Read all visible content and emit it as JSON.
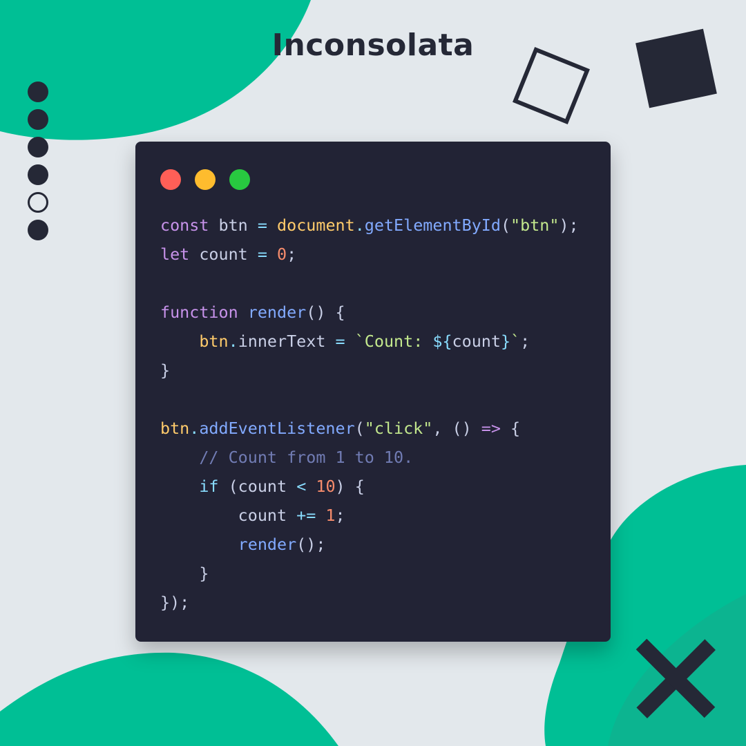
{
  "title": "Inconsolata",
  "colors": {
    "background": "#e3e8ec",
    "accent_green": "#00bf95",
    "dark": "#252836",
    "card": "#222335",
    "traffic_red": "#ff5f57",
    "traffic_yellow": "#febc2e",
    "traffic_green": "#28c840"
  },
  "decorations": {
    "nav_dots": [
      "filled",
      "filled",
      "filled",
      "filled",
      "hollow",
      "filled"
    ],
    "shapes": [
      "outline-square-icon",
      "filled-square-icon",
      "cross-icon"
    ]
  },
  "window": {
    "traffic_lights": [
      "close-icon",
      "minimize-icon",
      "maximize-icon"
    ]
  },
  "code": {
    "lines": [
      [
        [
          "kw",
          "const"
        ],
        [
          "pl",
          " btn "
        ],
        [
          "op",
          "="
        ],
        [
          "pl",
          " "
        ],
        [
          "obj",
          "document"
        ],
        [
          "op",
          "."
        ],
        [
          "fn",
          "getElementById"
        ],
        [
          "pl",
          "("
        ],
        [
          "str",
          "\"btn\""
        ],
        [
          "pl",
          ");"
        ]
      ],
      [
        [
          "kw",
          "let"
        ],
        [
          "pl",
          " count "
        ],
        [
          "op",
          "="
        ],
        [
          "pl",
          " "
        ],
        [
          "num",
          "0"
        ],
        [
          "pl",
          ";"
        ]
      ],
      [],
      [
        [
          "kw",
          "function"
        ],
        [
          "pl",
          " "
        ],
        [
          "fn",
          "render"
        ],
        [
          "pl",
          "() {"
        ]
      ],
      [
        [
          "pl",
          "    "
        ],
        [
          "obj",
          "btn"
        ],
        [
          "op",
          "."
        ],
        [
          "pl",
          "innerText "
        ],
        [
          "op",
          "="
        ],
        [
          "pl",
          " "
        ],
        [
          "str",
          "`Count: "
        ],
        [
          "op",
          "${"
        ],
        [
          "pl",
          "count"
        ],
        [
          "op",
          "}"
        ],
        [
          "str",
          "`"
        ],
        [
          "pl",
          ";"
        ]
      ],
      [
        [
          "pl",
          "}"
        ]
      ],
      [],
      [
        [
          "obj",
          "btn"
        ],
        [
          "op",
          "."
        ],
        [
          "fn",
          "addEventListener"
        ],
        [
          "pl",
          "("
        ],
        [
          "str",
          "\"click\""
        ],
        [
          "pl",
          ", () "
        ],
        [
          "kw",
          "=>"
        ],
        [
          "pl",
          " {"
        ]
      ],
      [
        [
          "pl",
          "    "
        ],
        [
          "cm",
          "// Count from 1 to 10."
        ]
      ],
      [
        [
          "pl",
          "    "
        ],
        [
          "op",
          "if"
        ],
        [
          "pl",
          " (count "
        ],
        [
          "op",
          "<"
        ],
        [
          "pl",
          " "
        ],
        [
          "num",
          "10"
        ],
        [
          "pl",
          ") {"
        ]
      ],
      [
        [
          "pl",
          "        count "
        ],
        [
          "op",
          "+="
        ],
        [
          "pl",
          " "
        ],
        [
          "num",
          "1"
        ],
        [
          "pl",
          ";"
        ]
      ],
      [
        [
          "pl",
          "        "
        ],
        [
          "fn",
          "render"
        ],
        [
          "pl",
          "();"
        ]
      ],
      [
        [
          "pl",
          "    }"
        ]
      ],
      [
        [
          "pl",
          "});"
        ]
      ]
    ]
  }
}
